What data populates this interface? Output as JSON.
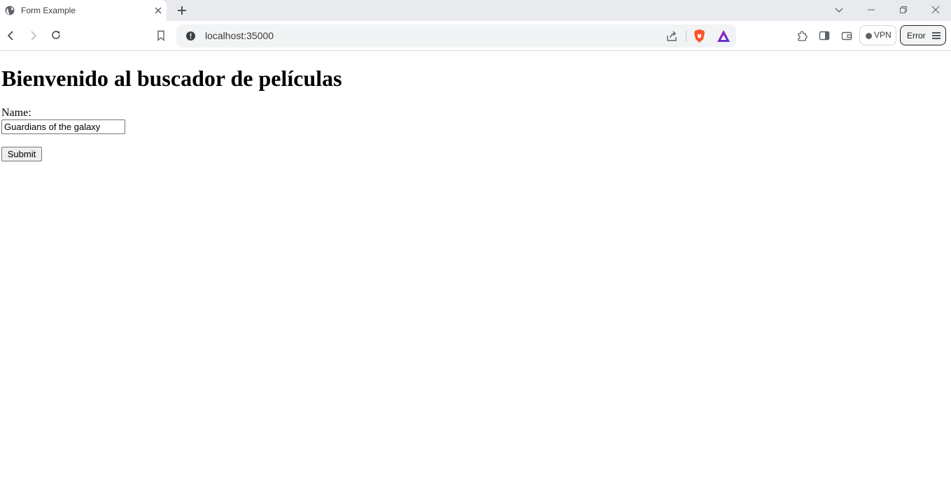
{
  "browser": {
    "tab": {
      "title": "Form Example",
      "favicon": "globe-icon"
    },
    "url": "localhost:35000",
    "vpn_label": "VPN",
    "error_label": "Error"
  },
  "page": {
    "heading": "Bienvenido al buscador de películas",
    "form": {
      "name_label": "Name:",
      "name_value": "Guardians of the galaxy",
      "submit_label": "Submit"
    }
  }
}
